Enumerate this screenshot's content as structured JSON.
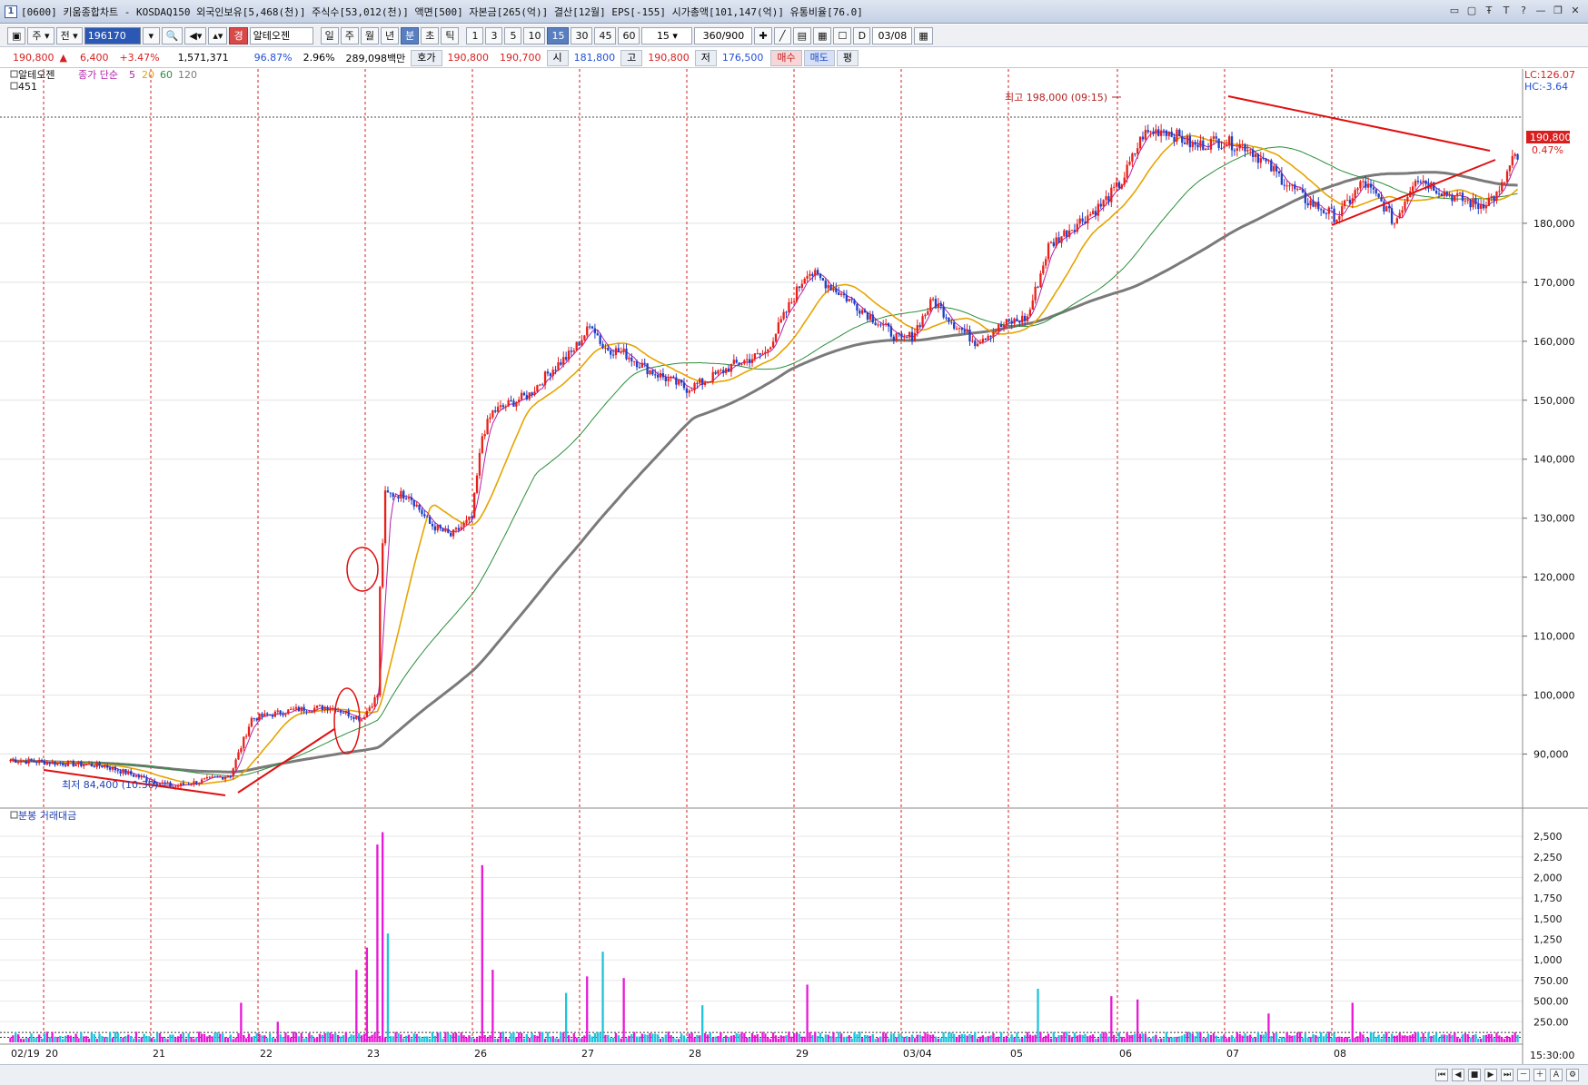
{
  "window": {
    "title": "[0600] 키움종합차트 - KOSDAQ150 외국인보유[5,468(천)] 주식수[53,012(천)] 액면[500] 자본금[265(억)] 결산[12월] EPS[-155] 시가총액[101,147(억)] 유통비율[76.0]",
    "controls": [
      "▭",
      "▢",
      "Ŧ",
      "T",
      "?",
      "—",
      "❐",
      "✕"
    ]
  },
  "toolbar": {
    "market_type": "주",
    "market_sub": "전",
    "stock_code": "196170",
    "stock_name": "알테오젠",
    "period_buttons": [
      "일",
      "주",
      "월",
      "년",
      "분",
      "초",
      "틱"
    ],
    "active_period": "분",
    "interval_buttons": [
      "1",
      "3",
      "5",
      "10",
      "15",
      "30",
      "45",
      "60"
    ],
    "active_interval": "15",
    "interval_value": "15",
    "count": "360/900",
    "date": "03/08"
  },
  "quote": {
    "price": "190,800",
    "change_arrow": "▲",
    "change": "6,400",
    "change_rate": "+3.47%",
    "volume": "1,571,371",
    "ratio1": "96.87%",
    "ratio2": "2.96%",
    "amount": "289,098백만",
    "bid_ask_label": "호가",
    "ask": "190,800",
    "bid": "190,700",
    "open_label": "시",
    "open": "181,800",
    "high_label": "고",
    "high": "190,800",
    "low_label": "저",
    "low": "176,500",
    "buy_label": "매수",
    "sell_label": "매도",
    "eval_label": "평"
  },
  "price_panel": {
    "stock_label": "알테오젠",
    "ma_label": "종가 단순",
    "ma_periods": [
      "5",
      "20",
      "60",
      "120"
    ],
    "ma_colors": [
      "#b21fa8",
      "#e6a400",
      "#2a8f3a",
      "#7a7a7a"
    ],
    "top_left_value": "451",
    "lc": "LC:126.07",
    "hc": "HC:-3.64",
    "current_price_tag": "190,800",
    "current_pct_tag": "0.47%",
    "high_annotation": "최고 198,000 (09:15)",
    "low_annotation": "최저 84,400 (10:30)",
    "y_ticks": [
      "180,000",
      "170,000",
      "160,000",
      "150,000",
      "140,000",
      "130,000",
      "120,000",
      "110,000",
      "100,000",
      "90,000"
    ]
  },
  "volume_panel": {
    "label": "분봉 거래대금",
    "y_ticks": [
      "2,500",
      "2,250",
      "2,000",
      "1,750",
      "1,500",
      "1,250",
      "1,000",
      "750.00",
      "500.00",
      "250.00"
    ]
  },
  "x_axis": {
    "labels": [
      "02/19",
      "20",
      "21",
      "22",
      "23",
      "26",
      "27",
      "28",
      "29",
      "03/04",
      "05",
      "06",
      "07",
      "08"
    ],
    "time": "15:30:00"
  },
  "chart_data": {
    "type": "candlestick",
    "interval": "15분",
    "ylim": [
      83000,
      204000
    ],
    "yticks": [
      90000,
      100000,
      110000,
      120000,
      130000,
      140000,
      150000,
      160000,
      170000,
      180000
    ],
    "session_path": [
      [
        0,
        89000
      ],
      [
        36,
        88000
      ],
      [
        50,
        86000
      ],
      [
        62,
        84500
      ],
      [
        74,
        85500
      ],
      [
        84,
        86500
      ],
      [
        92,
        96000
      ],
      [
        108,
        97500
      ],
      [
        122,
        98000
      ],
      [
        134,
        96000
      ],
      [
        140,
        100000
      ],
      [
        141,
        118000
      ],
      [
        143,
        134000
      ],
      [
        152,
        134000
      ],
      [
        160,
        129000
      ],
      [
        168,
        127000
      ],
      [
        176,
        130000
      ],
      [
        180,
        144000
      ],
      [
        184,
        148000
      ],
      [
        198,
        151000
      ],
      [
        206,
        155000
      ],
      [
        214,
        158000
      ],
      [
        222,
        163000
      ],
      [
        226,
        159000
      ],
      [
        234,
        158000
      ],
      [
        244,
        155000
      ],
      [
        258,
        152000
      ],
      [
        264,
        153000
      ],
      [
        276,
        156000
      ],
      [
        288,
        158000
      ],
      [
        304,
        172000
      ],
      [
        314,
        169000
      ],
      [
        326,
        165000
      ],
      [
        340,
        160000
      ],
      [
        344,
        161000
      ],
      [
        352,
        167000
      ],
      [
        360,
        163000
      ],
      [
        368,
        160000
      ],
      [
        380,
        163000
      ],
      [
        388,
        164000
      ],
      [
        396,
        176000
      ],
      [
        404,
        179000
      ],
      [
        416,
        183000
      ],
      [
        424,
        187000
      ],
      [
        432,
        195000
      ],
      [
        440,
        196000
      ],
      [
        452,
        193000
      ],
      [
        460,
        194000
      ],
      [
        472,
        193000
      ],
      [
        484,
        188000
      ],
      [
        494,
        184000
      ],
      [
        506,
        181000
      ],
      [
        516,
        187000
      ],
      [
        524,
        183000
      ],
      [
        528,
        180000
      ],
      [
        536,
        188000
      ],
      [
        548,
        185000
      ],
      [
        560,
        183000
      ],
      [
        568,
        185000
      ],
      [
        573,
        190800
      ]
    ],
    "ma_periods": [
      5,
      20,
      60,
      120
    ],
    "volume_ylim": [
      0,
      2600
    ],
    "volume_spikes": [
      [
        88,
        480
      ],
      [
        102,
        250
      ],
      [
        132,
        880
      ],
      [
        136,
        1150
      ],
      [
        140,
        2400
      ],
      [
        142,
        2550
      ],
      [
        144,
        1320
      ],
      [
        180,
        2150
      ],
      [
        184,
        880
      ],
      [
        212,
        600
      ],
      [
        220,
        800
      ],
      [
        226,
        1100
      ],
      [
        234,
        780
      ],
      [
        264,
        450
      ],
      [
        304,
        700
      ],
      [
        392,
        650
      ],
      [
        420,
        560
      ],
      [
        430,
        520
      ],
      [
        480,
        350
      ],
      [
        512,
        480
      ]
    ],
    "session_labels": [
      "02/19",
      "20",
      "21",
      "22",
      "23",
      "26",
      "27",
      "28",
      "29",
      "03/04",
      "05",
      "06",
      "07",
      "08"
    ],
    "high_point": {
      "label": "최고",
      "value": 198000,
      "time": "09:15"
    },
    "low_point": {
      "label": "최저",
      "value": 84400,
      "time": "10:30"
    },
    "last_price": 190800,
    "last_change_pct": "0.47%"
  }
}
